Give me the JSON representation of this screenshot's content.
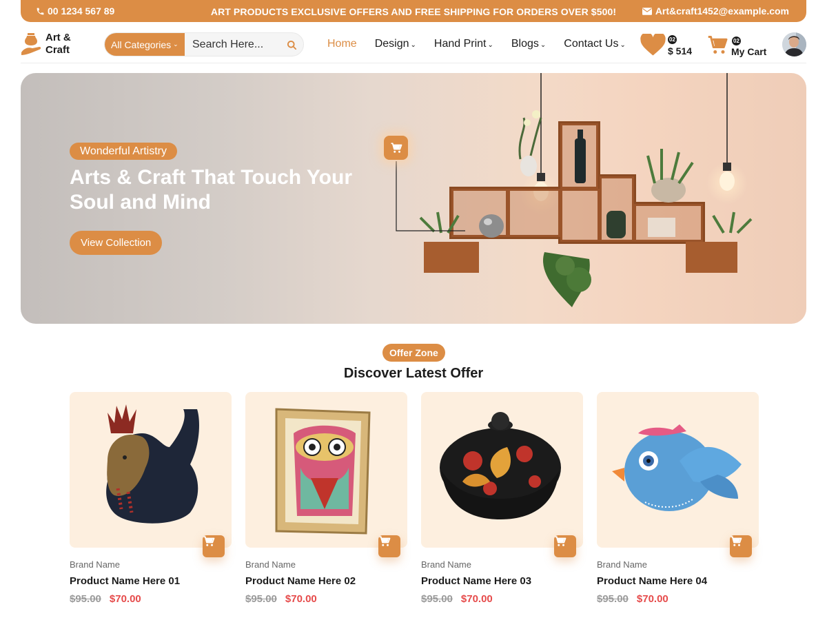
{
  "topbar": {
    "phone": "00 1234 567 89",
    "promo": "ART PRODUCTS EXCLUSIVE OFFERS AND FREE SHIPPING FOR ORDERS OVER $500!",
    "email": "Art&craft1452@example.com"
  },
  "logo": {
    "line1": "Art &",
    "line2": "Craft"
  },
  "search": {
    "category": "All Categories",
    "placeholder": "Search Here..."
  },
  "nav": {
    "items": [
      {
        "label": "Home",
        "active": true
      },
      {
        "label": "Design",
        "dropdown": true
      },
      {
        "label": "Hand Print",
        "dropdown": true
      },
      {
        "label": "Blogs",
        "dropdown": true
      },
      {
        "label": "Contact Us",
        "dropdown": true
      }
    ]
  },
  "wishlist": {
    "count": "02",
    "amount": "$ 514"
  },
  "cart": {
    "count": "02",
    "label": "My Cart"
  },
  "hero": {
    "tag": "Wonderful Artistry",
    "title": "Arts & Craft That Touch Your Soul and Mind",
    "button": "View Collection"
  },
  "offer": {
    "tag": "Offer Zone",
    "title": "Discover Latest Offer"
  },
  "products": [
    {
      "brand": "Brand Name",
      "name": "Product Name Here 01",
      "old_price": "$95.00",
      "price": "$70.00",
      "image": "rooster-figurine"
    },
    {
      "brand": "Brand Name",
      "name": "Product Name Here 02",
      "old_price": "$95.00",
      "price": "$70.00",
      "image": "owl-painting-frame"
    },
    {
      "brand": "Brand Name",
      "name": "Product Name Here 03",
      "old_price": "$95.00",
      "price": "$70.00",
      "image": "lacquered-bowl"
    },
    {
      "brand": "Brand Name",
      "name": "Product Name Here 04",
      "old_price": "$95.00",
      "price": "$70.00",
      "image": "blue-bird-figurine"
    }
  ],
  "colors": {
    "accent": "#dc8d45",
    "sale": "#e64b4b",
    "card_bg": "#fdefdf"
  }
}
